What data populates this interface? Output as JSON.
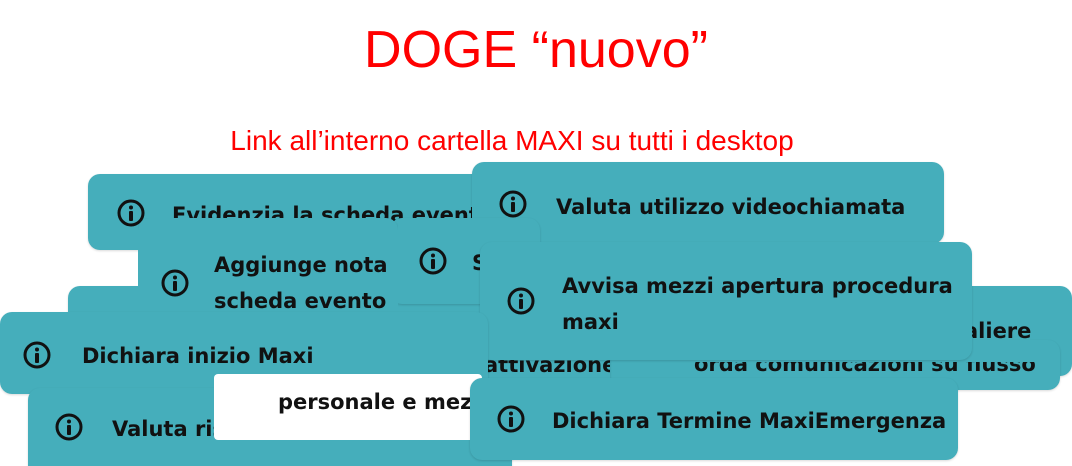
{
  "header": {
    "title": "DOGE “nuovo”",
    "subtitle": "Link all’interno cartella MAXI su tutti i desktop"
  },
  "cards": {
    "evidenzia": "Evidenzia la scheda evento",
    "valuta_video": "Valuta utilizzo videochiamata",
    "aggiunge_nota_1": "Aggiunge nota",
    "aggiunge_nota_2": "scheda evento",
    "s_fragment": "S",
    "avvisa_1": "Avvisa mezzi apertura procedura",
    "avvisa_2": "maxi",
    "aliere": "aliere",
    "dichiara_inizio": "Dichiara inizio Maxi",
    "attivazione": "attivazione",
    "comunicazioni": "orda comunicazioni su flusso",
    "personale": "personale e mezzi",
    "valuta_ris": "Valuta ris",
    "dichiara_termine": "Dichiara Termine MaxiEmergenza"
  },
  "icon": "info-circle-icon",
  "colors": {
    "accent_red": "#ff0000",
    "card_teal": "#45aebb"
  }
}
